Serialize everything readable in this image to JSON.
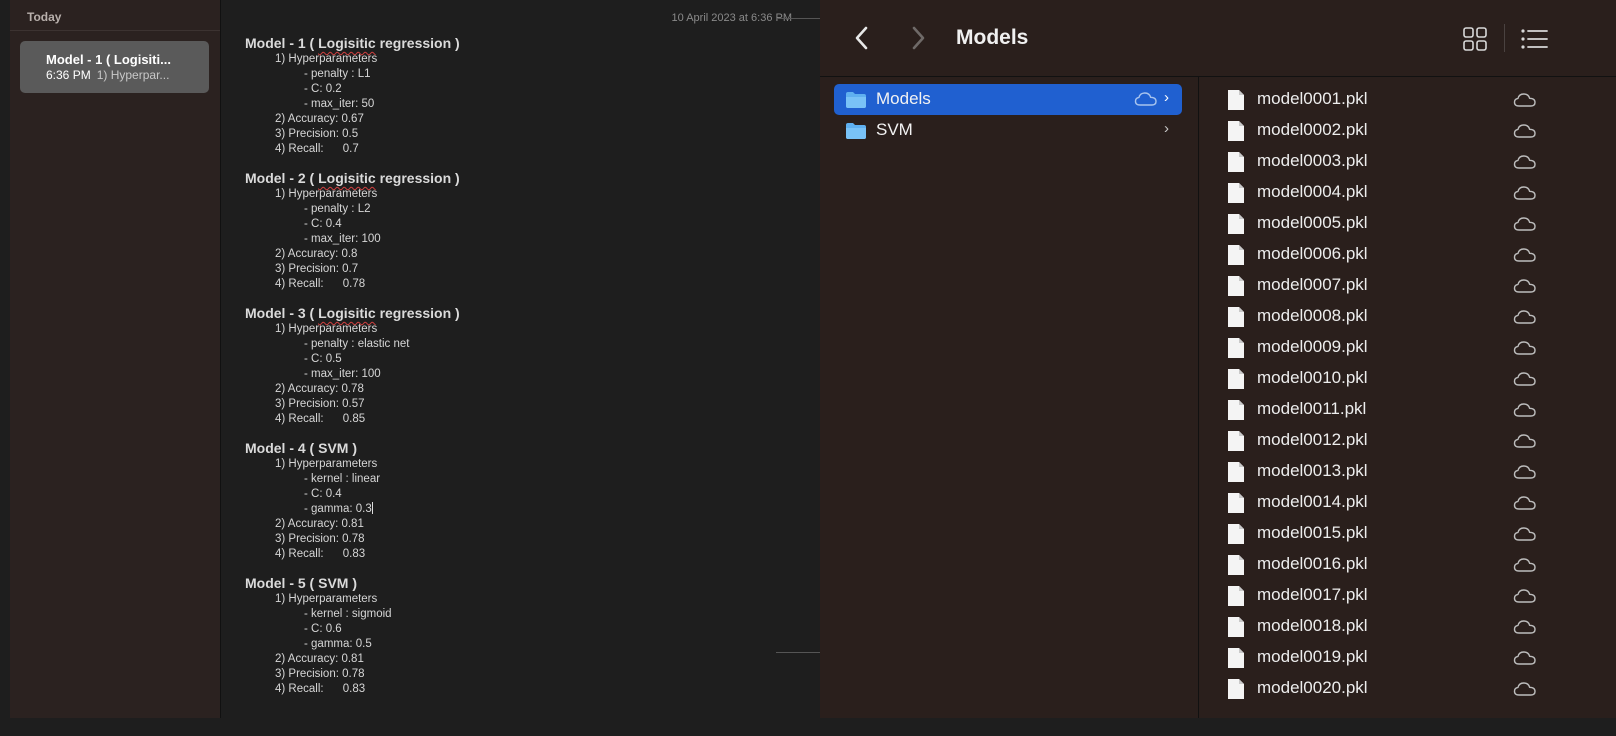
{
  "notes": {
    "sidebar_header": "Today",
    "note_card": {
      "title": "Model - 1 ( Logisiti...",
      "time": "6:36 PM",
      "preview": "1) Hyperpar..."
    },
    "date": "10 April 2023 at 6:36 PM",
    "models": [
      {
        "title_prefix": "Model - 1 ( ",
        "title_word": "Logisitic",
        "title_suffix": " regression )",
        "hyper_label": "1) Hyperparameters",
        "params": [
          "- penalty : L1",
          "- C: 0.2",
          "- max_iter: 50"
        ],
        "accuracy": "2) Accuracy: 0.67",
        "precision": "3) Precision: 0.5",
        "recall": "4) Recall:      0.7"
      },
      {
        "title_prefix": "Model - 2 ( ",
        "title_word": "Logisitic",
        "title_suffix": " regression )",
        "hyper_label": "1) Hyperparameters",
        "params": [
          "- penalty : L2",
          "- C: 0.4",
          "- max_iter: 100"
        ],
        "accuracy": "2) Accuracy: 0.8",
        "precision": "3) Precision: 0.7",
        "recall": "4) Recall:      0.78"
      },
      {
        "title_prefix": "Model - 3 ( ",
        "title_word": "Logisitic",
        "title_suffix": " regression )",
        "hyper_label": "1) Hyperparameters",
        "params": [
          "- penalty : elastic net",
          "- C: 0.5",
          "- max_iter: 100"
        ],
        "accuracy": "2) Accuracy: 0.78",
        "precision": "3) Precision: 0.57",
        "recall": "4) Recall:      0.85"
      },
      {
        "title_prefix": "Model - 4 ( SVM )",
        "title_word": "",
        "title_suffix": "",
        "hyper_label": "1) Hyperparameters",
        "params": [
          "- kernel : linear",
          "- C: 0.4",
          "- gamma: 0.3"
        ],
        "accuracy": "2) Accuracy: 0.81",
        "precision": "3) Precision: 0.78",
        "recall": "4) Recall:      0.83"
      },
      {
        "title_prefix": "Model - 5 ( SVM )",
        "title_word": "",
        "title_suffix": "",
        "hyper_label": "1) Hyperparameters",
        "params": [
          "- kernel : sigmoid",
          "- C: 0.6",
          "- gamma: 0.5"
        ],
        "accuracy": "2) Accuracy: 0.81",
        "precision": "3) Precision: 0.78",
        "recall": "4) Recall:      0.83"
      }
    ]
  },
  "finder": {
    "title": "Models",
    "back_icon": "chevron-left-icon",
    "forward_icon": "chevron-right-icon",
    "folders": [
      {
        "label": "Models",
        "selected": true,
        "cloud": true
      },
      {
        "label": "SVM",
        "selected": false,
        "cloud": false
      }
    ],
    "files": [
      "model0001.pkl",
      "model0002.pkl",
      "model0003.pkl",
      "model0004.pkl",
      "model0005.pkl",
      "model0006.pkl",
      "model0007.pkl",
      "model0008.pkl",
      "model0009.pkl",
      "model0010.pkl",
      "model0011.pkl",
      "model0012.pkl",
      "model0013.pkl",
      "model0014.pkl",
      "model0015.pkl",
      "model0016.pkl",
      "model0017.pkl",
      "model0018.pkl",
      "model0019.pkl",
      "model0020.pkl"
    ]
  },
  "colors": {
    "selection": "#2060d0",
    "folder": "#5fb0f0",
    "spellcheck": "#d04040"
  }
}
